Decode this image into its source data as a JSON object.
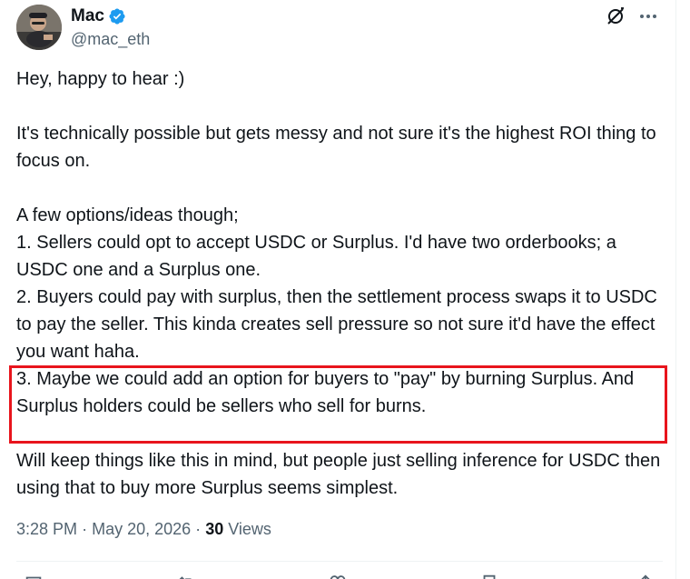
{
  "author": {
    "display_name": "Mac",
    "handle": "@mac_eth",
    "verified": true
  },
  "header_icons": {
    "grok": "grok-icon",
    "more": "more-icon"
  },
  "tweet": {
    "paragraph_1": "Hey, happy to hear :)",
    "paragraph_2": "It's technically possible but gets messy and not sure it's the highest ROI thing to focus on.",
    "paragraph_3_intro": "A few options/ideas though;",
    "option_1": "1. Sellers could opt to accept USDC or Surplus. I'd have two orderbooks; a USDC one and a Surplus one.",
    "option_2": "2. Buyers could pay with surplus, then the settlement process swaps it to USDC to pay the seller. This kinda creates sell pressure so not sure it'd have the effect you want haha.",
    "option_3": "3. Maybe we could add an option for buyers to \"pay\" by burning Surplus. And Surplus holders could be sellers who sell for burns.",
    "closing": "Will keep things like this in mind, but people just selling inference for USDC then using that to buy more Surplus seems simplest."
  },
  "meta": {
    "time": "3:28 PM",
    "separator": "·",
    "date": "May 20, 2026",
    "views_count": "30",
    "views_label": "Views"
  },
  "colors": {
    "verified_blue": "#1d9bf0",
    "highlight_red": "#e8141c",
    "secondary_text": "#536471",
    "primary_text": "#0f1419"
  },
  "action_icons": [
    "reply-icon",
    "repost-icon",
    "like-icon",
    "bookmark-icon",
    "share-icon"
  ]
}
